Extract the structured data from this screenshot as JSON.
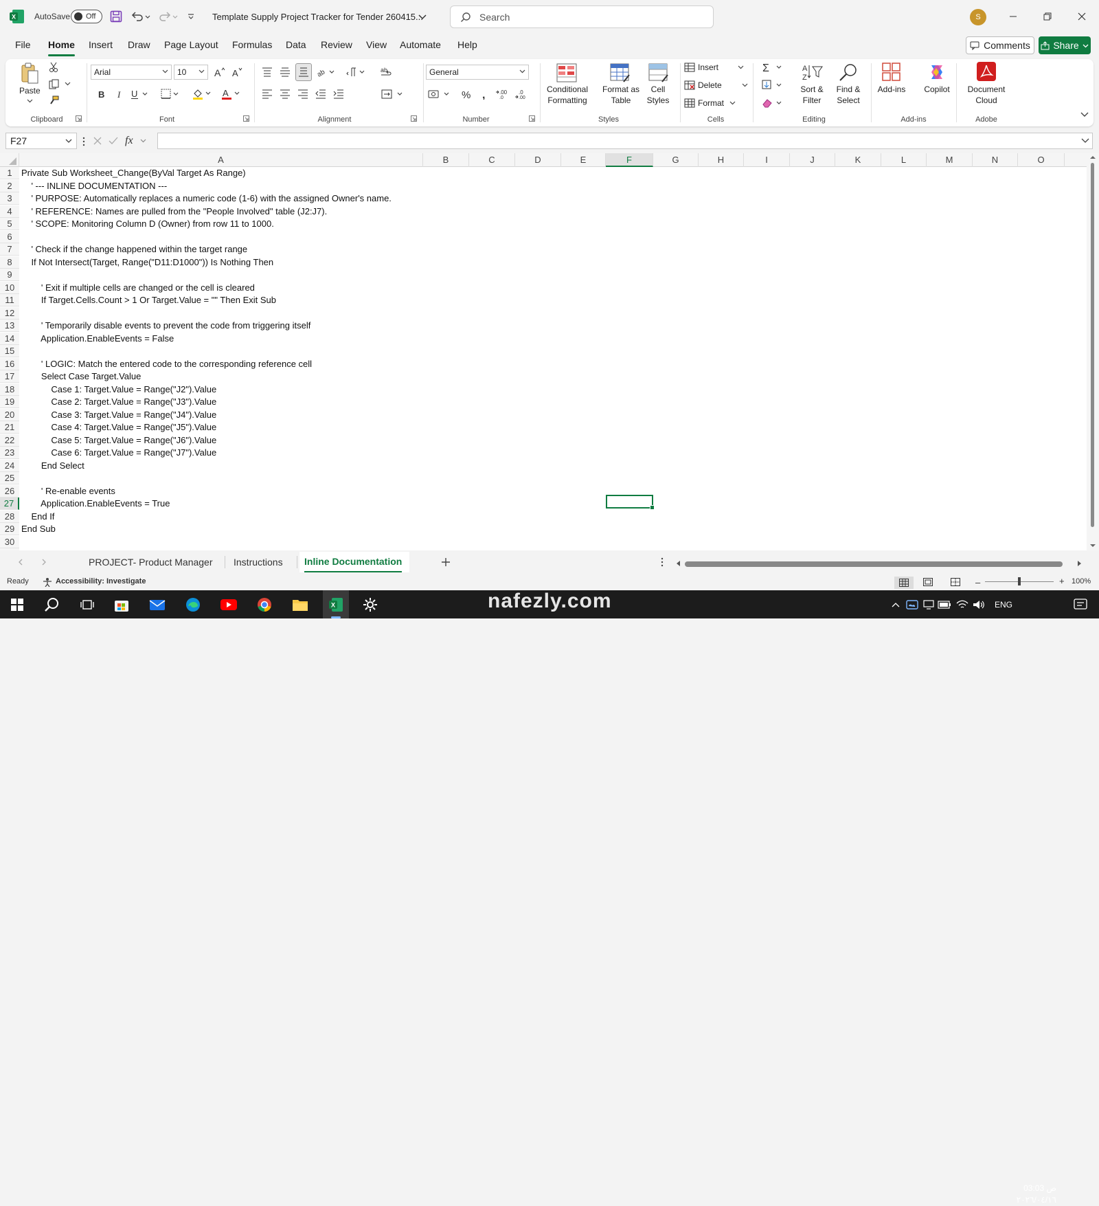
{
  "titlebar": {
    "autosave_label": "AutoSave",
    "autosave_state": "Off",
    "file_title": "Template Supply Project Tracker for Tender 260415...",
    "search_placeholder": "Search",
    "avatar_initial": "S"
  },
  "menu": {
    "tabs": [
      "File",
      "Home",
      "Insert",
      "Draw",
      "Page Layout",
      "Formulas",
      "Data",
      "Review",
      "View",
      "Automate",
      "Help"
    ],
    "active": "Home",
    "comments_label": "Comments",
    "share_label": "Share"
  },
  "ribbon": {
    "clipboard": {
      "label": "Clipboard",
      "paste": "Paste"
    },
    "font": {
      "label": "Font",
      "font_name": "Arial",
      "font_size": "10"
    },
    "alignment": {
      "label": "Alignment"
    },
    "number": {
      "label": "Number",
      "format": "General"
    },
    "styles": {
      "label": "Styles",
      "conditional_1": "Conditional",
      "conditional_2": "Formatting",
      "format_table_1": "Format as",
      "format_table_2": "Table",
      "cell_styles_1": "Cell",
      "cell_styles_2": "Styles"
    },
    "cells": {
      "label": "Cells",
      "insert": "Insert",
      "delete": "Delete",
      "format": "Format"
    },
    "editing": {
      "label": "Editing",
      "sort_1": "Sort &",
      "sort_2": "Filter",
      "find_1": "Find &",
      "find_2": "Select"
    },
    "addins": {
      "label": "Add-ins",
      "addins_btn": "Add-ins",
      "copilot": "Copilot"
    },
    "adobe": {
      "label": "Adobe",
      "doc_1": "Document",
      "doc_2": "Cloud"
    }
  },
  "formula_bar": {
    "name_box": "F27",
    "fx": "fx",
    "content": ""
  },
  "grid": {
    "columns": [
      "A",
      "B",
      "C",
      "D",
      "E",
      "F",
      "G",
      "H",
      "I",
      "J",
      "K",
      "L",
      "M",
      "N",
      "O"
    ],
    "selected_column": "F",
    "selected_row": 27,
    "rows": [
      "Private Sub Worksheet_Change(ByVal Target As Range)",
      "    ' --- INLINE DOCUMENTATION ---",
      "    ' PURPOSE: Automatically replaces a numeric code (1-6) with the assigned Owner's name.",
      "    ' REFERENCE: Names are pulled from the \"People Involved\" table (J2:J7).",
      "    ' SCOPE: Monitoring Column D (Owner) from row 11 to 1000.",
      "",
      "    ' Check if the change happened within the target range",
      "    If Not Intersect(Target, Range(\"D11:D1000\")) Is Nothing Then",
      "",
      "        ' Exit if multiple cells are changed or the cell is cleared",
      "        If Target.Cells.Count > 1 Or Target.Value = \"\" Then Exit Sub",
      "",
      "        ' Temporarily disable events to prevent the code from triggering itself",
      "        Application.EnableEvents = False",
      "",
      "        ' LOGIC: Match the entered code to the corresponding reference cell",
      "        Select Case Target.Value",
      "            Case 1: Target.Value = Range(\"J2\").Value",
      "            Case 2: Target.Value = Range(\"J3\").Value",
      "            Case 3: Target.Value = Range(\"J4\").Value",
      "            Case 4: Target.Value = Range(\"J5\").Value",
      "            Case 5: Target.Value = Range(\"J6\").Value",
      "            Case 6: Target.Value = Range(\"J7\").Value",
      "        End Select",
      "",
      "        ' Re-enable events",
      "        Application.EnableEvents = True",
      "    End If",
      "End Sub",
      ""
    ]
  },
  "sheets": {
    "tabs": [
      "PROJECT- Product Manager",
      "Instructions",
      "Inline Documentation"
    ],
    "active": "Inline Documentation"
  },
  "status": {
    "ready": "Ready",
    "accessibility": "Accessibility: Investigate",
    "zoom": "100%"
  },
  "taskbar": {
    "lang": "ENG",
    "time": "03:03 ص",
    "date": "٢٠٢٦/٠٤/١٦",
    "watermark": "nafezly.com"
  },
  "colors": {
    "accent": "#107c41",
    "selected_header": "#e1e1e1"
  }
}
